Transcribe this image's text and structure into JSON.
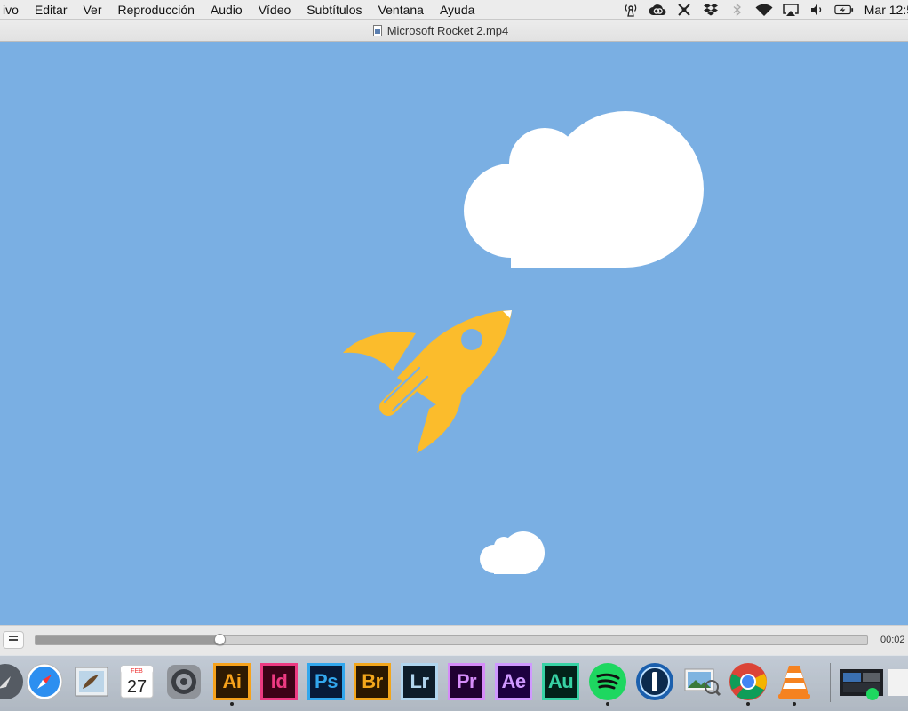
{
  "menubar": {
    "items": [
      "ivo",
      "Editar",
      "Ver",
      "Reproducción",
      "Audio",
      "Vídeo",
      "Subtítulos",
      "Ventana",
      "Ayuda"
    ],
    "status_icons": [
      "airport-sync-icon",
      "creative-cloud-icon",
      "adobe-sync-icon",
      "dropbox-icon",
      "bluetooth-icon",
      "wifi-icon",
      "airplay-icon",
      "volume-icon",
      "battery-charging-icon"
    ],
    "clock": "Mar 12:5"
  },
  "window": {
    "title": "Microsoft Rocket 2.mp4"
  },
  "video": {
    "background": "#7aafe3",
    "rocket_color": "#fbbc2c",
    "cloud_color": "#ffffff"
  },
  "controls": {
    "progress_fraction": 0.222,
    "time": "00:02"
  },
  "dock": {
    "items": [
      {
        "name": "launchpad-icon",
        "kind": "round",
        "bg": "#555b63",
        "running": false
      },
      {
        "name": "safari-icon",
        "kind": "safari",
        "running": false
      },
      {
        "name": "mail-icon",
        "kind": "mail",
        "running": false
      },
      {
        "name": "calendar-icon",
        "kind": "calendar",
        "month": "FEB",
        "day": "27",
        "running": false
      },
      {
        "name": "system-preferences-icon",
        "kind": "gear",
        "running": false
      },
      {
        "name": "illustrator-icon",
        "kind": "adobe",
        "label": "Ai",
        "bg": "#2e1a02",
        "fg": "#f7a21b",
        "running": true
      },
      {
        "name": "indesign-icon",
        "kind": "adobe",
        "label": "Id",
        "bg": "#3d0217",
        "fg": "#ed3a82",
        "running": false
      },
      {
        "name": "photoshop-icon",
        "kind": "adobe",
        "label": "Ps",
        "bg": "#071a38",
        "fg": "#32a7ed",
        "running": false
      },
      {
        "name": "bridge-icon",
        "kind": "adobe",
        "label": "Br",
        "bg": "#2b1800",
        "fg": "#f3a61b",
        "running": false
      },
      {
        "name": "lightroom-icon",
        "kind": "adobe",
        "label": "Lr",
        "bg": "#0d1d2a",
        "fg": "#b0d5ee",
        "running": false
      },
      {
        "name": "premiere-icon",
        "kind": "adobe",
        "label": "Pr",
        "bg": "#200031",
        "fg": "#d58cf8",
        "running": false
      },
      {
        "name": "after-effects-icon",
        "kind": "adobe",
        "label": "Ae",
        "bg": "#1d0040",
        "fg": "#cf99ff",
        "running": false
      },
      {
        "name": "audition-icon",
        "kind": "adobe",
        "label": "Au",
        "bg": "#022219",
        "fg": "#37d2a4",
        "running": false
      },
      {
        "name": "spotify-icon",
        "kind": "spotify",
        "running": true
      },
      {
        "name": "1password-icon",
        "kind": "onepass",
        "running": false
      },
      {
        "name": "preview-icon",
        "kind": "preview",
        "running": false
      },
      {
        "name": "chrome-icon",
        "kind": "chrome",
        "running": true
      },
      {
        "name": "vlc-icon",
        "kind": "vlc",
        "running": true
      },
      {
        "name": "minimized-window-thumbnail",
        "kind": "thumb",
        "running": false
      }
    ]
  }
}
